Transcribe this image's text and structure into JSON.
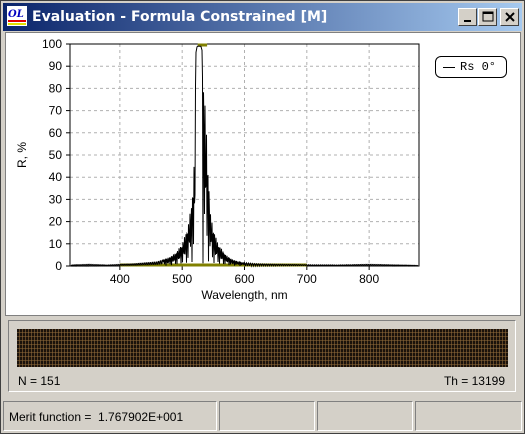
{
  "window": {
    "title": "Evaluation - Formula Constrained [M]",
    "buttons": [
      "minimize",
      "maximize",
      "close"
    ]
  },
  "chart_data": {
    "type": "line",
    "xlabel": "Wavelength, nm",
    "ylabel": "R, %",
    "xlim": [
      320,
      880
    ],
    "ylim": [
      0,
      100
    ],
    "x_ticks": [
      "400",
      "500",
      "600",
      "700",
      "800"
    ],
    "y_ticks": [
      "0",
      "10",
      "20",
      "30",
      "40",
      "50",
      "60",
      "70",
      "80",
      "90",
      "100"
    ],
    "grid": true,
    "legend": "top-right",
    "series": [
      {
        "name": "Rs 0°",
        "color": "#000000",
        "x": [
          320,
          350,
          380,
          400,
          420,
          440,
          460,
          470,
          480,
          490,
          495,
          500,
          505,
          510,
          515,
          520,
          522,
          524,
          526,
          528,
          530,
          532,
          540,
          545,
          550,
          555,
          560,
          565,
          570,
          575,
          580,
          590,
          600,
          620,
          650,
          700,
          750,
          800,
          850,
          880
        ],
        "values": [
          0.5,
          0.8,
          0.5,
          0.8,
          1,
          1.5,
          2,
          3,
          4,
          6,
          8,
          10,
          14,
          19,
          28,
          50,
          96,
          99,
          99,
          99,
          99,
          97,
          55,
          24,
          17,
          12,
          9,
          7,
          5,
          4,
          3,
          2,
          1.5,
          1,
          0.8,
          0.6,
          0.5,
          0.8,
          0.5,
          0.3
        ]
      }
    ],
    "targets": {
      "color": "#808000",
      "top_band": [
        525,
        540,
        100
      ],
      "bottom_band": [
        400,
        700,
        0
      ]
    }
  },
  "legend": {
    "label": "Rs 0°"
  },
  "strip": {
    "n_label": "N = 151",
    "th_label": "Th = 13199"
  },
  "status": {
    "merit_label": "Merit function =  1.767902E+001",
    "cells": [
      "",
      "",
      ""
    ]
  }
}
